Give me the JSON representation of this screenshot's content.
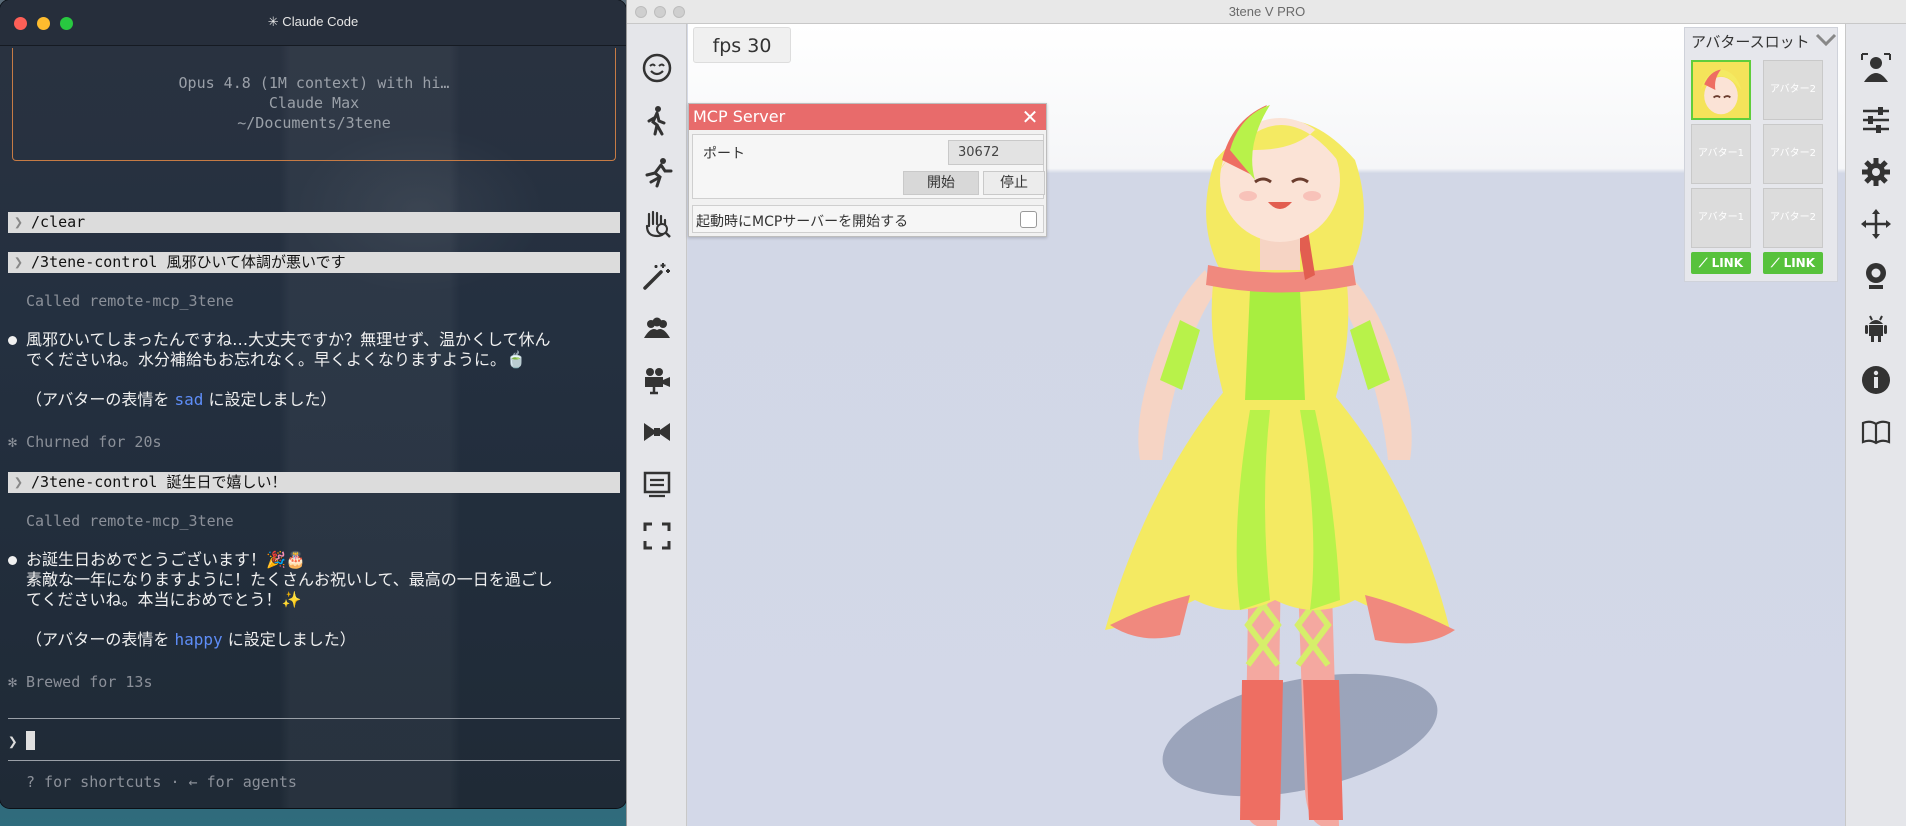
{
  "terminal": {
    "title": "✳ Claude Code",
    "banner": {
      "model_line": "Opus 4.8 (1M context) with hi…",
      "plan_line": "Claude Max",
      "path_line": "~/Documents/3tene"
    },
    "prompt_glyph": "❯",
    "blocks": [
      {
        "command": "/clear"
      },
      {
        "command": "/3tene-control 風邪ひいて体調が悪いです",
        "tool": "Called remote-mcp_3tene",
        "reply_lines": [
          "風邪ひいてしまったんですね…大丈夫ですか？無理せず、温かくして休ん",
          "でくださいね。水分補給もお忘れなく。早くよくなりますように。🍵"
        ],
        "status_prefix": "（アバターの表情を ",
        "status_value": "sad",
        "status_suffix": " に設定しました）",
        "elapsed": "✻ Churned for 20s"
      },
      {
        "command": "/3tene-control 誕生日で嬉しい！",
        "tool": "Called remote-mcp_3tene",
        "reply_lines": [
          "お誕生日おめでとうございます！🎉🎂",
          "素敵な一年になりますように！たくさんお祝いして、最高の一日を過ごし",
          "てくださいね。本当におめでとう！✨"
        ],
        "status_prefix": "（アバターの表情を ",
        "status_value": "happy",
        "status_suffix": " に設定しました）",
        "elapsed": "✻ Brewed for 13s"
      }
    ],
    "footer_hint": "? for shortcuts · ← for agents"
  },
  "app": {
    "title": "3tene V PRO",
    "fps_label": "fps  30",
    "left_tools": [
      "face-icon",
      "walk-icon",
      "run-icon",
      "hand-search-icon",
      "magic-wand-icon",
      "group-icon",
      "camera-icon",
      "ribbon-icon",
      "screen-icon",
      "fullscreen-icon"
    ],
    "right_tools": [
      "person-icon",
      "sliders-icon",
      "gear-icon",
      "move-icon",
      "webcam-icon",
      "robot-icon",
      "info-icon",
      "book-icon"
    ],
    "mcp": {
      "title": "MCP Server",
      "port_label": "ポート",
      "port_value": "30672",
      "start_label": "開始",
      "stop_label": "停止",
      "autostart_label": "起動時にMCPサーバーを開始する",
      "autostart_checked": false
    },
    "slots": {
      "title": "アバタースロット",
      "labels": [
        "アバター2",
        "アバター1",
        "アバター2",
        "アバター1",
        "アバター2"
      ],
      "link_label": "LINK"
    }
  },
  "colors": {
    "terminal_bg": "#232b38",
    "banner_border": "#c67b45",
    "accent_blue": "#5e8df7",
    "mcp_header": "#e86b6b",
    "link_green": "#57c23c"
  }
}
